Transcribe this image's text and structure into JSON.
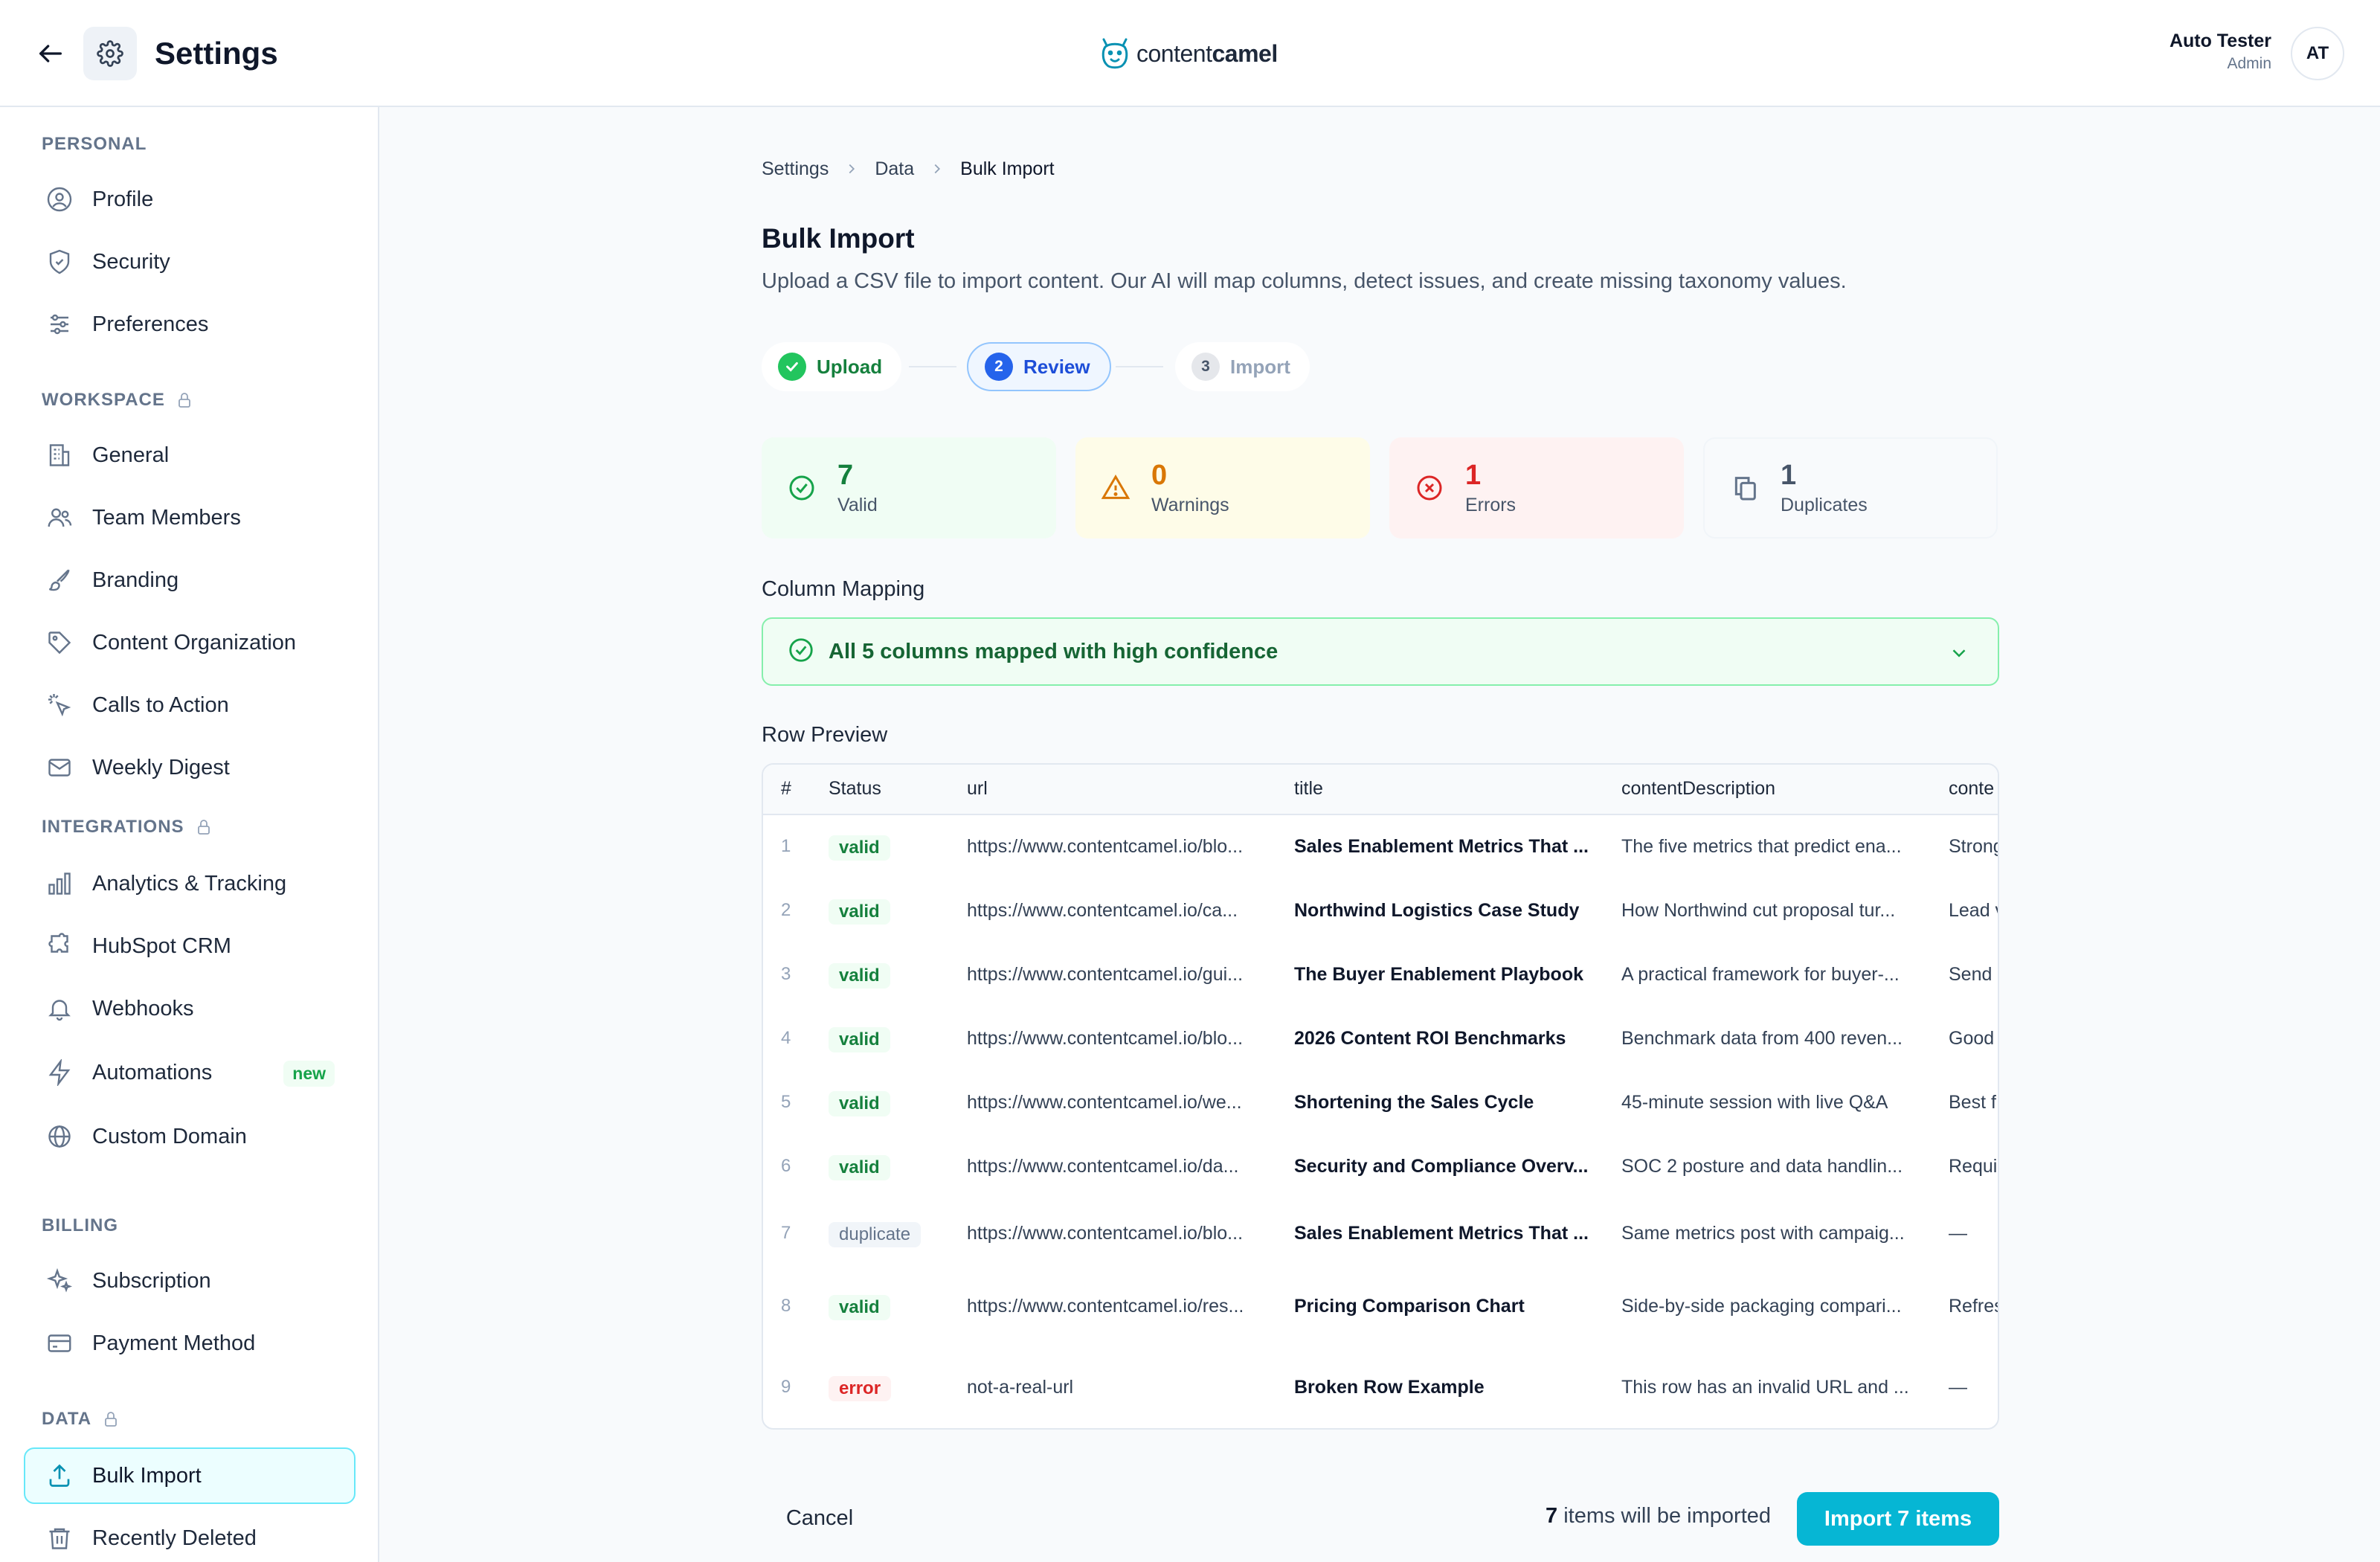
{
  "header": {
    "title": "Settings",
    "logo_prefix": "content",
    "logo_suffix": "camel",
    "user_name": "Auto Tester",
    "user_role": "Admin",
    "avatar_initials": "AT"
  },
  "sidebar": {
    "sections": {
      "personal": "PERSONAL",
      "workspace": "WORKSPACE",
      "integrations": "INTEGRATIONS",
      "billing": "BILLING",
      "data": "DATA"
    },
    "items": {
      "profile": "Profile",
      "security": "Security",
      "preferences": "Preferences",
      "general": "General",
      "team_members": "Team Members",
      "branding": "Branding",
      "content_organization": "Content Organization",
      "calls_to_action": "Calls to Action",
      "weekly_digest": "Weekly Digest",
      "analytics": "Analytics & Tracking",
      "hubspot": "HubSpot CRM",
      "webhooks": "Webhooks",
      "automations": "Automations",
      "automations_badge": "new",
      "custom_domain": "Custom Domain",
      "subscription": "Subscription",
      "payment_method": "Payment Method",
      "bulk_import": "Bulk Import",
      "recently_deleted": "Recently Deleted"
    }
  },
  "breadcrumb": [
    "Settings",
    "Data",
    "Bulk Import"
  ],
  "page": {
    "title": "Bulk Import",
    "subtitle": "Upload a CSV file to import content. Our AI will map columns, detect issues, and create missing taxonomy values."
  },
  "steps": [
    {
      "label": "Upload",
      "state": "done"
    },
    {
      "label": "Review",
      "num": "2",
      "state": "active"
    },
    {
      "label": "Import",
      "num": "3",
      "state": "pending"
    }
  ],
  "stats": {
    "valid": {
      "value": "7",
      "label": "Valid"
    },
    "warnings": {
      "value": "0",
      "label": "Warnings"
    },
    "errors": {
      "value": "1",
      "label": "Errors"
    },
    "duplicates": {
      "value": "1",
      "label": "Duplicates"
    }
  },
  "mapping": {
    "heading": "Column Mapping",
    "summary": "All 5 columns mapped with high confidence"
  },
  "preview": {
    "heading": "Row Preview",
    "columns": [
      "#",
      "Status",
      "url",
      "title",
      "contentDescription",
      "conte"
    ],
    "rows": [
      {
        "n": "1",
        "status": "valid",
        "url": "https://www.contentcamel.io/blo...",
        "title": "Sales Enablement Metrics That ...",
        "desc": "The five metrics that predict ena...",
        "extra": "Strong"
      },
      {
        "n": "2",
        "status": "valid",
        "url": "https://www.contentcamel.io/ca...",
        "title": "Northwind Logistics Case Study",
        "desc": "How Northwind cut proposal tur...",
        "extra": "Lead v"
      },
      {
        "n": "3",
        "status": "valid",
        "url": "https://www.contentcamel.io/gui...",
        "title": "The Buyer Enablement Playbook",
        "desc": "A practical framework for buyer-...",
        "extra": "Send"
      },
      {
        "n": "4",
        "status": "valid",
        "url": "https://www.contentcamel.io/blo...",
        "title": "2026 Content ROI Benchmarks",
        "desc": "Benchmark data from 400 reven...",
        "extra": "Good"
      },
      {
        "n": "5",
        "status": "valid",
        "url": "https://www.contentcamel.io/we...",
        "title": "Shortening the Sales Cycle",
        "desc": "45-minute session with live Q&A",
        "extra": "Best f"
      },
      {
        "n": "6",
        "status": "valid",
        "url": "https://www.contentcamel.io/da...",
        "title": "Security and Compliance Overv...",
        "desc": "SOC 2 posture and data handlin...",
        "extra": "Requi"
      },
      {
        "n": "7",
        "status": "duplicate",
        "url": "https://www.contentcamel.io/blo...",
        "title": "Sales Enablement Metrics That ...",
        "desc": "Same metrics post with campaig...",
        "extra": "—"
      },
      {
        "n": "8",
        "status": "valid",
        "url": "https://www.contentcamel.io/res...",
        "title": "Pricing Comparison Chart",
        "desc": "Side-by-side packaging compari...",
        "extra": "Refres"
      },
      {
        "n": "9",
        "status": "error",
        "url": "not-a-real-url",
        "title": "Broken Row Example",
        "desc": "This row has an invalid URL and ...",
        "extra": "—"
      }
    ]
  },
  "footer": {
    "cancel": "Cancel",
    "summary_count": "7",
    "summary_text": " items will be imported",
    "import_label": "Import 7 items"
  },
  "colors": {
    "accent": "#06b6d4",
    "valid": "#15803d",
    "warning": "#d97706",
    "error": "#dc2626",
    "active_step": "#2563eb"
  }
}
